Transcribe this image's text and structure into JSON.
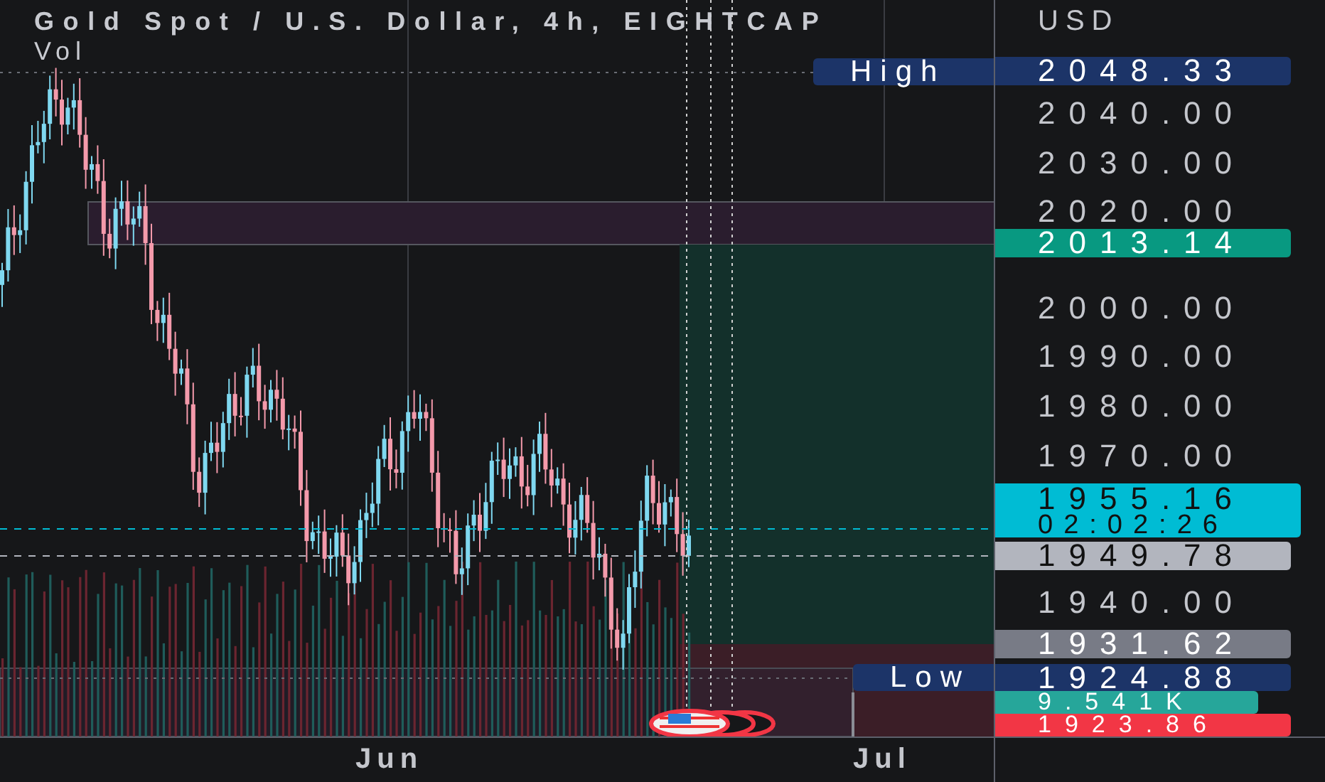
{
  "legend": {
    "title": "Gold Spot / U.S. Dollar, 4h, EIGHTCAP",
    "indicator": "Vol"
  },
  "currency": "USD",
  "price_ticks": [
    "2040.00",
    "2030.00",
    "2020.00",
    "2000.00",
    "1990.00",
    "1980.00",
    "1970.00",
    "1940.00"
  ],
  "price_labels": [
    {
      "kind": "single",
      "text": "2048.33",
      "color": "#1c3468"
    },
    {
      "kind": "single",
      "text": "2013.14",
      "color": "#089981"
    },
    {
      "kind": "countdown",
      "text": "1955.16",
      "subtext": "02:02:26",
      "color": "#00bcd4"
    },
    {
      "kind": "single",
      "text": "1949.78",
      "color": "#b2b5be"
    },
    {
      "kind": "single",
      "text": "1931.62",
      "color": "#787b86"
    },
    {
      "kind": "single",
      "text": "1924.88",
      "color": "#1c3468"
    },
    {
      "kind": "single",
      "text": "9.541K",
      "color": "#26a69a"
    },
    {
      "kind": "single",
      "text": "1923.86",
      "color": "#f23645"
    }
  ],
  "chart_tags": [
    {
      "text": "High"
    },
    {
      "text": "Low"
    }
  ],
  "time_ticks": [
    "Jun",
    "Jul"
  ]
}
